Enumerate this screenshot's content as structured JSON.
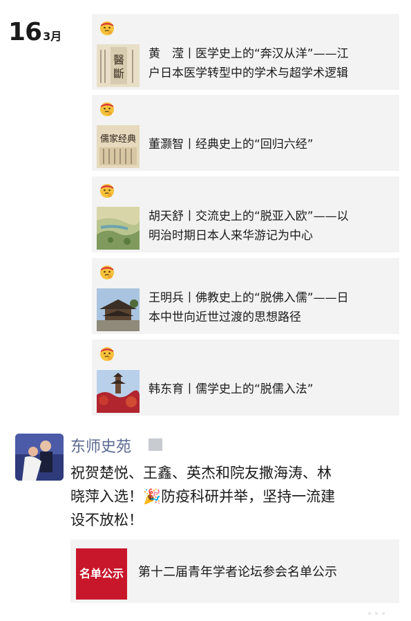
{
  "date": {
    "day": "16",
    "month": "3月"
  },
  "feed_items": [
    {
      "emoji": "thinking-face-icon",
      "title_line1": "黄　滢丨医学史上的“奔汉从洋”——江",
      "title_line2": "户日本医学转型中的学术与超学术逻辑",
      "thumb": "book-calligraphy-thumbnail"
    },
    {
      "emoji": "thinking-face-icon",
      "title_line1": "董灏智丨经典史上的“回归六经”",
      "title_line2": "",
      "thumb": "classics-calligraphy-thumbnail"
    },
    {
      "emoji": "thinking-face-icon",
      "title_line1": "胡天舒丨交流史上的“脱亚入欧”——以",
      "title_line2": "明治时期日本人来华游记为中心",
      "thumb": "landscape-painting-thumbnail"
    },
    {
      "emoji": "thinking-face-icon",
      "title_line1": "王明兵丨佛教史上的“脱佛入儒”——日",
      "title_line2": "本中世向近世过渡的思想路径",
      "thumb": "temple-photo-thumbnail"
    },
    {
      "emoji": "thinking-face-icon",
      "title_line1": "韩东育丨儒学史上的“脱儒入法”",
      "title_line2": "",
      "thumb": "pagoda-photo-thumbnail"
    }
  ],
  "post": {
    "username": "东师史苑",
    "text_line1": "祝贺楚悦、王鑫、英杰和院友撒海涛、林",
    "text_line2": "晓萍入选！🎉防疫科研并举，坚持一流建",
    "text_line3": "设不放松！",
    "share": {
      "thumb_text": "名单公示",
      "title": "第十二届青年学者论坛参会名单公示"
    }
  }
}
